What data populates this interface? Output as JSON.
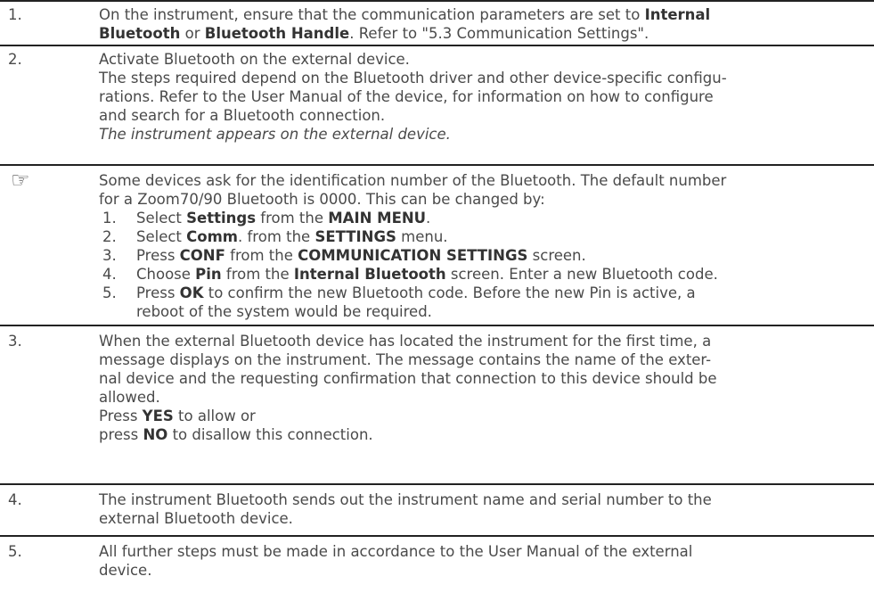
{
  "steps": [
    {
      "num": "1.",
      "lines": [
        [
          "On the instrument, ensure that the communication parameters are set to ",
          {
            "b": "Internal"
          }
        ],
        [
          {
            "b": "Bluetooth"
          },
          " or ",
          {
            "b": "Bluetooth Handle"
          },
          ". Refer to \"5.3 Communication Settings\"."
        ]
      ]
    },
    {
      "num": "2.",
      "lines": [
        [
          "Activate Bluetooth on the external device."
        ],
        [
          "The steps required depend on the Bluetooth driver and other device-specific configu-"
        ],
        [
          "rations. Refer to the User Manual of the device, for information on how to configure"
        ],
        [
          "and search for a Bluetooth connection."
        ],
        [
          {
            "i": "The instrument appears on the external device."
          }
        ]
      ]
    },
    {
      "num": "☞",
      "lines": [
        [
          "Some devices ask for the identification number of the Bluetooth. The default number"
        ],
        [
          "for a Zoom70/90 Bluetooth is 0000. This can be changed by:"
        ]
      ],
      "substeps": [
        {
          "n": "1.",
          "parts": [
            "Select ",
            {
              "b": "Settings"
            },
            " from the ",
            {
              "b": "MAIN MENU"
            },
            "."
          ]
        },
        {
          "n": "2.",
          "parts": [
            "Select ",
            {
              "b": "Comm"
            },
            ". from the ",
            {
              "b": "SETTINGS"
            },
            " menu."
          ]
        },
        {
          "n": "3.",
          "parts": [
            "Press ",
            {
              "b": "CONF"
            },
            " from the ",
            {
              "b": "COMMUNICATION SETTINGS"
            },
            " screen."
          ]
        },
        {
          "n": "4.",
          "parts": [
            "Choose ",
            {
              "b": "Pin"
            },
            " from the ",
            {
              "b": "Internal Bluetooth"
            },
            " screen. Enter a new Bluetooth code."
          ]
        },
        {
          "n": "5.",
          "parts": [
            "Press ",
            {
              "b": "OK"
            },
            " to confirm the new Bluetooth code. Before the new Pin is active, a"
          ]
        },
        {
          "n": "",
          "parts": [
            "reboot of the system would be required."
          ]
        }
      ]
    },
    {
      "num": "3.",
      "lines": [
        [
          "When the external Bluetooth device has located the instrument for the first time, a"
        ],
        [
          "message displays on the instrument. The message contains the name of the exter-"
        ],
        [
          "nal device and the requesting confirmation that connection to this device should be"
        ],
        [
          "allowed."
        ],
        [
          "Press ",
          {
            "b": "YES"
          },
          " to allow or"
        ],
        [
          "press ",
          {
            "b": "NO"
          },
          " to disallow this connection."
        ]
      ]
    },
    {
      "num": "4.",
      "lines": [
        [
          "The instrument Bluetooth sends out the instrument name and serial number to the"
        ],
        [
          "external Bluetooth device."
        ]
      ]
    },
    {
      "num": "5.",
      "lines": [
        [
          "All further steps must be made in accordance to the User Manual of the external"
        ],
        [
          "device."
        ]
      ]
    }
  ]
}
